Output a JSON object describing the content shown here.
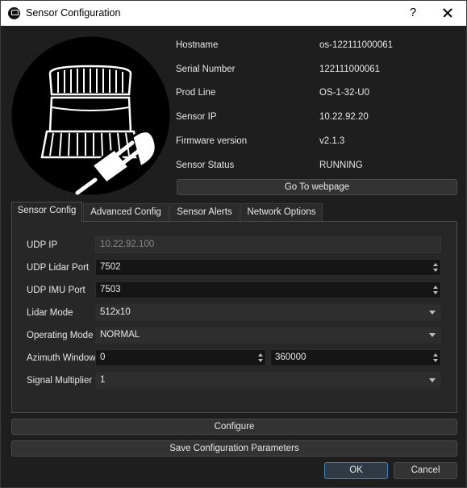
{
  "window": {
    "title": "Sensor Configuration",
    "help_glyph": "?"
  },
  "info": [
    {
      "label": "Hostname",
      "value": "os-122111000061"
    },
    {
      "label": "Serial Number",
      "value": "122111000061"
    },
    {
      "label": "Prod Line",
      "value": "OS-1-32-U0"
    },
    {
      "label": "Sensor IP",
      "value": "10.22.92.20"
    },
    {
      "label": "Firmware version",
      "value": "v2.1.3"
    },
    {
      "label": "Sensor Status",
      "value": "RUNNING"
    }
  ],
  "goto_button": "Go To webpage",
  "tabs": [
    "Sensor Config",
    "Advanced Config",
    "Sensor Alerts",
    "Network Options"
  ],
  "form": {
    "udp_ip": {
      "label": "UDP IP",
      "value": "10.22.92.100"
    },
    "udp_lidar_port": {
      "label": "UDP Lidar Port",
      "value": "7502"
    },
    "udp_imu_port": {
      "label": "UDP IMU Port",
      "value": "7503"
    },
    "lidar_mode": {
      "label": "Lidar Mode",
      "value": "512x10"
    },
    "operating_mode": {
      "label": "Operating Mode",
      "value": "NORMAL"
    },
    "azimuth_window": {
      "label": "Azimuth Window",
      "start": "0",
      "end": "360000"
    },
    "signal_multiplier": {
      "label": "Signal Multiplier",
      "value": "1"
    }
  },
  "buttons": {
    "configure": "Configure",
    "save": "Save Configuration Parameters",
    "ok": "OK",
    "cancel": "Cancel"
  },
  "colors": {
    "background": "#1e1e1e",
    "panel": "#272727",
    "field": "#151515",
    "accent": "#3c84c4"
  }
}
